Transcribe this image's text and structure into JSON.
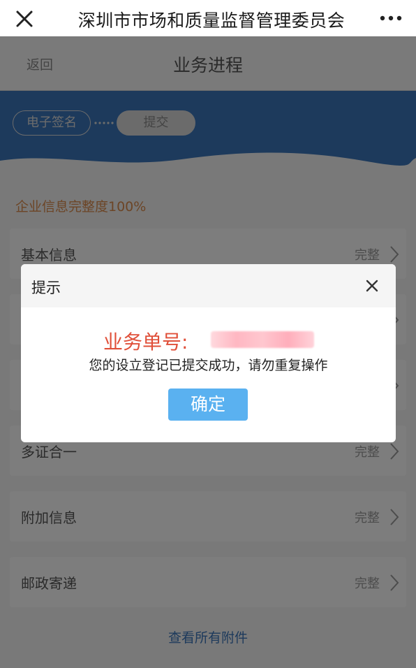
{
  "wechat_bar": {
    "title": "深圳市市场和质量监督管理委员会"
  },
  "nav": {
    "back_label": "返回",
    "title": "业务进程"
  },
  "steps": [
    {
      "label": "电子签名"
    },
    {
      "label": "提交"
    }
  ],
  "completeness": "企业信息完整度100%",
  "sections": [
    {
      "label": "基本信息",
      "status": "完整"
    },
    {
      "label": "",
      "status": ""
    },
    {
      "label": "",
      "status": ""
    },
    {
      "label": "多证合一",
      "status": "完整"
    },
    {
      "label": "附加信息",
      "status": "完整"
    },
    {
      "label": "邮政寄递",
      "status": "完整"
    }
  ],
  "view_attachments": "查看所有附件",
  "dialog": {
    "title": "提示",
    "order_label": "业务单号:",
    "message": "您的设立登记已提交成功，请勿重复操作",
    "confirm_label": "确定"
  },
  "colors": {
    "banner": "#3b74b8",
    "completeness": "#d88a4c",
    "order_number": "#e0503a",
    "confirm_button": "#5ab1f0"
  }
}
